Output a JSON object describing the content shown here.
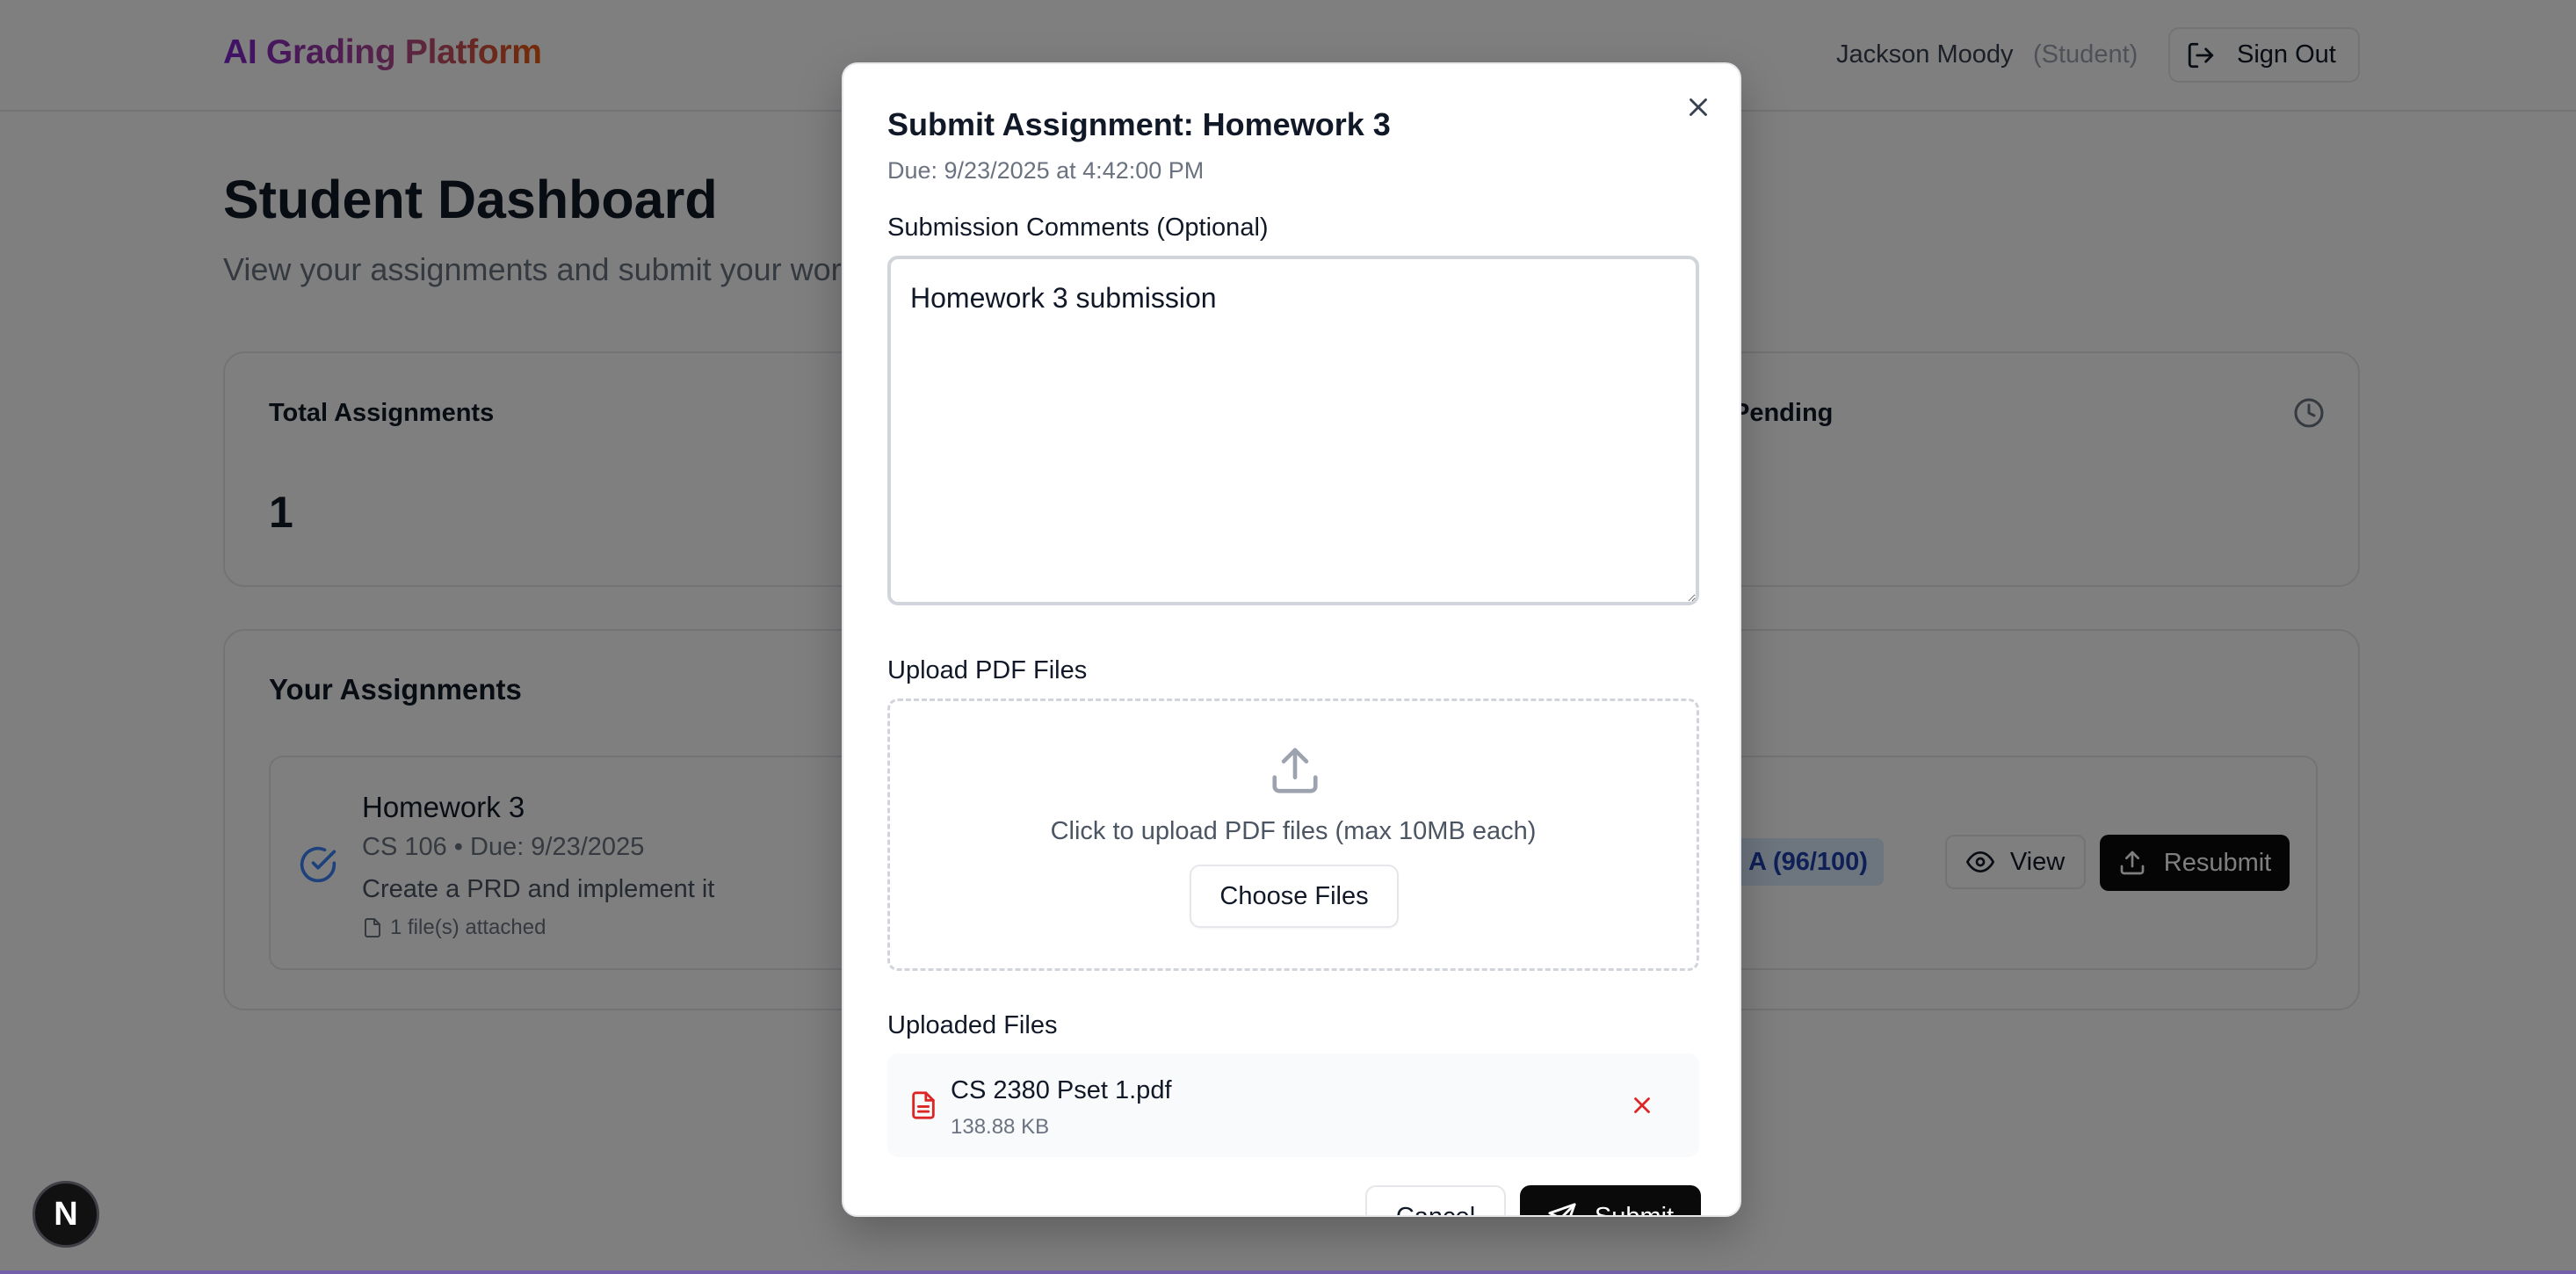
{
  "header": {
    "brand": "AI Grading Platform",
    "user_name": "Jackson Moody",
    "user_role": "(Student)",
    "sign_out_label": "Sign Out"
  },
  "dashboard": {
    "title": "Student Dashboard",
    "subtitle": "View your assignments and submit your work",
    "stats": [
      {
        "label": "Total Assignments",
        "value": "1"
      },
      {
        "label": "Pending",
        "icon": "clock-icon"
      }
    ],
    "assignments_title": "Your Assignments",
    "assignments": [
      {
        "name": "Homework 3",
        "meta": "CS 106 • Due: 9/23/2025",
        "description": "Create a PRD and implement it",
        "files": "1 file(s) attached",
        "grade": "A (96/100)",
        "view_label": "View",
        "resubmit_label": "Resubmit",
        "status_icon": "check-circle-icon"
      }
    ]
  },
  "modal": {
    "title": "Submit Assignment: Homework 3",
    "due": "Due: 9/23/2025 at 4:42:00 PM",
    "comments_label": "Submission Comments (Optional)",
    "comments_value": "Homework 3 submission",
    "upload_label": "Upload PDF Files",
    "upload_hint": "Click to upload PDF files (max 10MB each)",
    "choose_files_label": "Choose Files",
    "uploaded_label": "Uploaded Files",
    "uploaded_files": [
      {
        "name": "CS 2380 Pset 1.pdf",
        "size": "138.88 KB"
      }
    ],
    "cancel_label": "Cancel",
    "submit_label": "Submit"
  },
  "colors": {
    "accent_dark": "#0a0a0a",
    "badge_bg": "#dbeafe",
    "badge_text": "#1e40af",
    "check_blue": "#3b82f6",
    "remove_red": "#dc2626"
  },
  "dev_badge": "N"
}
